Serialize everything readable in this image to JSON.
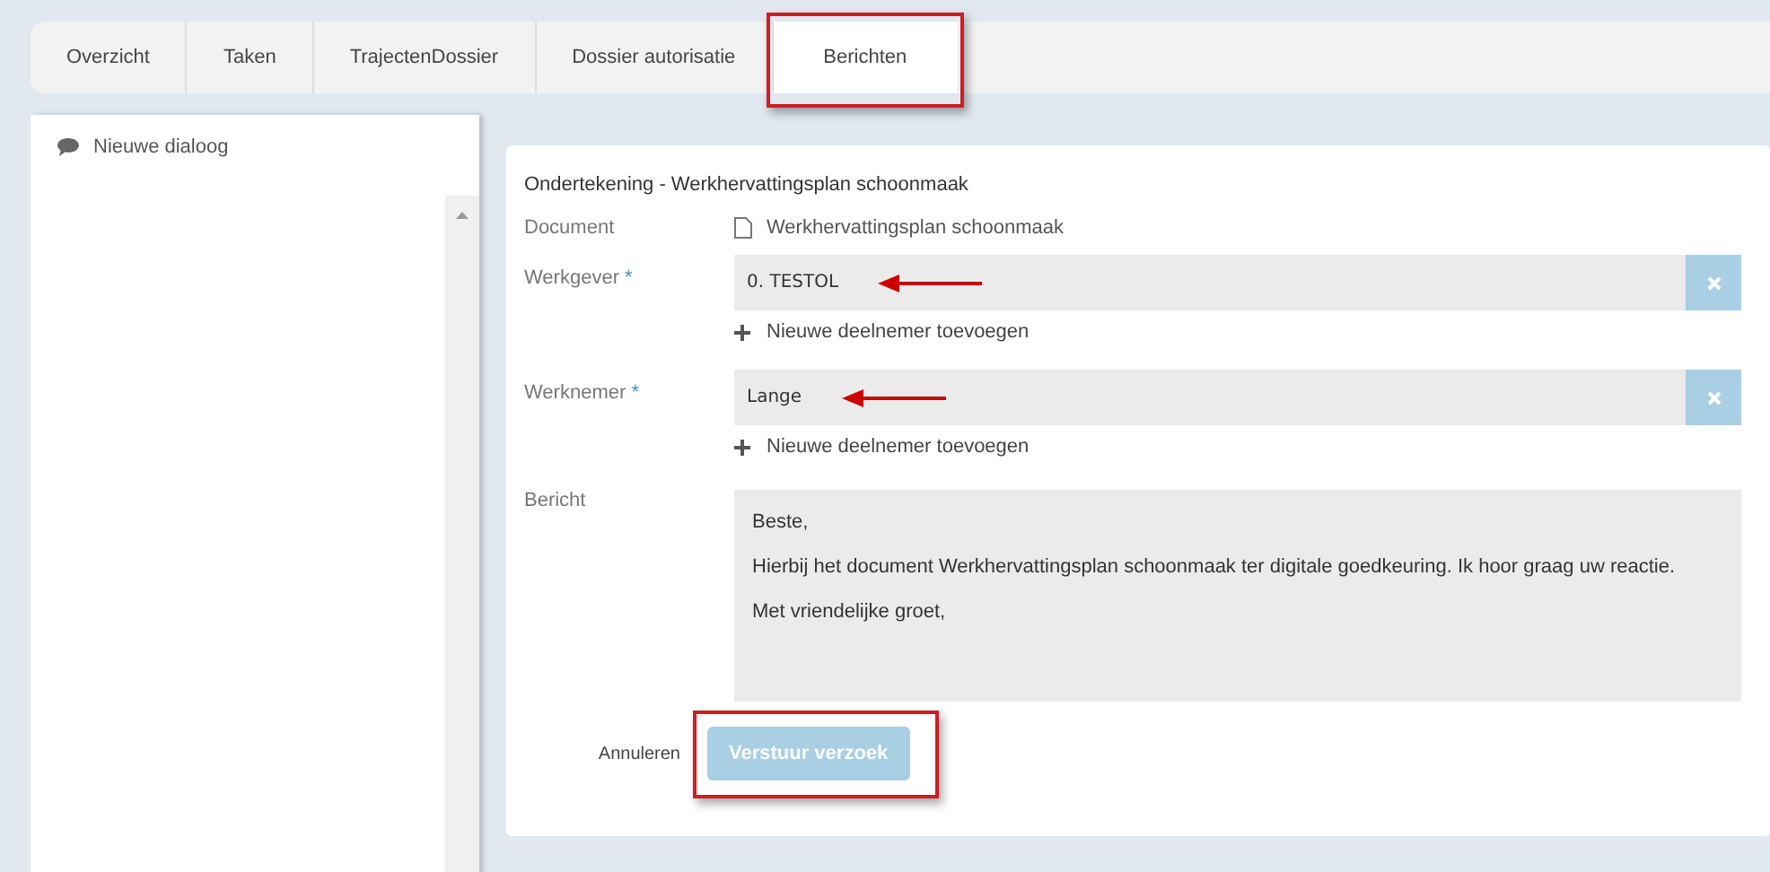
{
  "tabs": [
    {
      "label": "Overzicht",
      "selected": false,
      "highlighted": false
    },
    {
      "label": "Taken",
      "selected": false,
      "highlighted": false
    },
    {
      "label": "TrajectenDossier",
      "selected": false,
      "highlighted": false
    },
    {
      "label": "Dossier autorisatie",
      "selected": false,
      "highlighted": false
    },
    {
      "label": "Berichten",
      "selected": true,
      "highlighted": true
    }
  ],
  "sidebar": {
    "new_dialog": "Nieuwe dialoog"
  },
  "form": {
    "title": "Ondertekening - Werkhervattingsplan schoonmaak",
    "document": {
      "label": "Document",
      "value": "Werkhervattingsplan schoonmaak"
    },
    "participants": [
      {
        "label": "Werkgever",
        "required": "*",
        "value": "0. TESTOL",
        "arrow": true,
        "add": "Nieuwe deelnemer toevoegen"
      },
      {
        "label": "Werknemer",
        "required": "*",
        "value": "Lange",
        "arrow": true,
        "add": "Nieuwe deelnemer toevoegen"
      }
    ],
    "message": {
      "label": "Bericht",
      "paragraphs": [
        "Beste,",
        "Hierbij het document Werkhervattingsplan schoonmaak ter digitale goedkeuring. Ik hoor graag uw reactie.",
        "Met vriendelijke groet,"
      ]
    },
    "cancel": "Annuleren",
    "submit": {
      "label": "Verstuur verzoek",
      "highlighted": true
    }
  }
}
